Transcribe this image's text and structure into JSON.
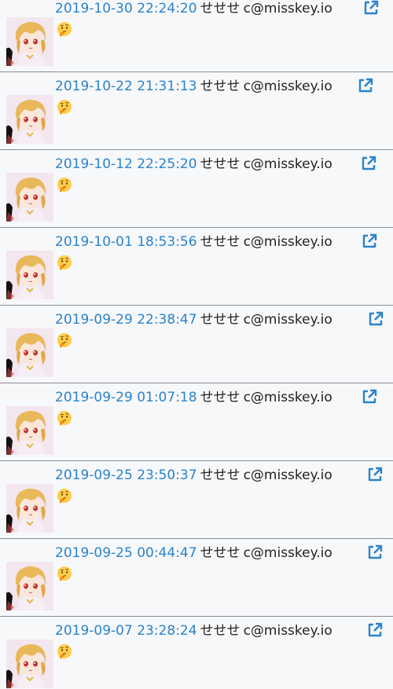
{
  "posts": [
    {
      "timestamp": "2019-10-30 22:24:20",
      "username": "せせせ",
      "acct": "c@misskey.io",
      "reaction": "thinking-face-emoji"
    },
    {
      "timestamp": "2019-10-22 21:31:13",
      "username": "せせせ",
      "acct": "c@misskey.io",
      "reaction": "thinking-face-emoji"
    },
    {
      "timestamp": "2019-10-12 22:25:20",
      "username": "せせせ",
      "acct": "c@misskey.io",
      "reaction": "thinking-face-emoji"
    },
    {
      "timestamp": "2019-10-01 18:53:56",
      "username": "せせせ",
      "acct": "c@misskey.io",
      "reaction": "thinking-face-emoji"
    },
    {
      "timestamp": "2019-09-29 22:38:47",
      "username": "せせせ",
      "acct": "c@misskey.io",
      "reaction": "thinking-face-emoji"
    },
    {
      "timestamp": "2019-09-29 01:07:18",
      "username": "せせせ",
      "acct": "c@misskey.io",
      "reaction": "thinking-face-emoji"
    },
    {
      "timestamp": "2019-09-25 23:50:37",
      "username": "せせせ",
      "acct": "c@misskey.io",
      "reaction": "thinking-face-emoji"
    },
    {
      "timestamp": "2019-09-25 00:44:47",
      "username": "せせせ",
      "acct": "c@misskey.io",
      "reaction": "thinking-face-emoji"
    },
    {
      "timestamp": "2019-09-07 23:28:24",
      "username": "せせせ",
      "acct": "c@misskey.io",
      "reaction": "thinking-face-emoji"
    }
  ],
  "icons": {
    "external_link": "external-link-icon",
    "avatar": "avatar"
  },
  "colors": {
    "link": "#2a83cc",
    "text": "#222222",
    "background": "#f7f8fa",
    "divider": "#888c90"
  }
}
